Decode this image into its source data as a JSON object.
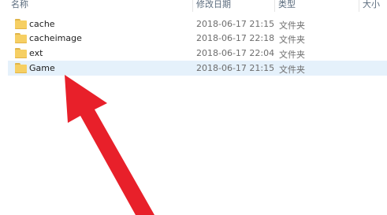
{
  "columns": {
    "name": "名称",
    "date": "修改日期",
    "type": "类型",
    "size": "大小"
  },
  "rows": [
    {
      "name": "cache",
      "date": "2018-06-17 21:15",
      "type": "文件夹",
      "icon": "folder-icon"
    },
    {
      "name": "cacheimage",
      "date": "2018-06-17 22:18",
      "type": "文件夹",
      "icon": "folder-icon"
    },
    {
      "name": "ext",
      "date": "2018-06-17 22:04",
      "type": "文件夹",
      "icon": "folder-icon"
    },
    {
      "name": "Game",
      "date": "2018-06-17 21:15",
      "type": "文件夹",
      "icon": "folder-icon"
    }
  ],
  "selected_row": "Game",
  "colors": {
    "arrow": "#e8202a",
    "selection": "#e5f1fb",
    "folder": "#f6cf63",
    "header_text": "#5a6b7d"
  }
}
